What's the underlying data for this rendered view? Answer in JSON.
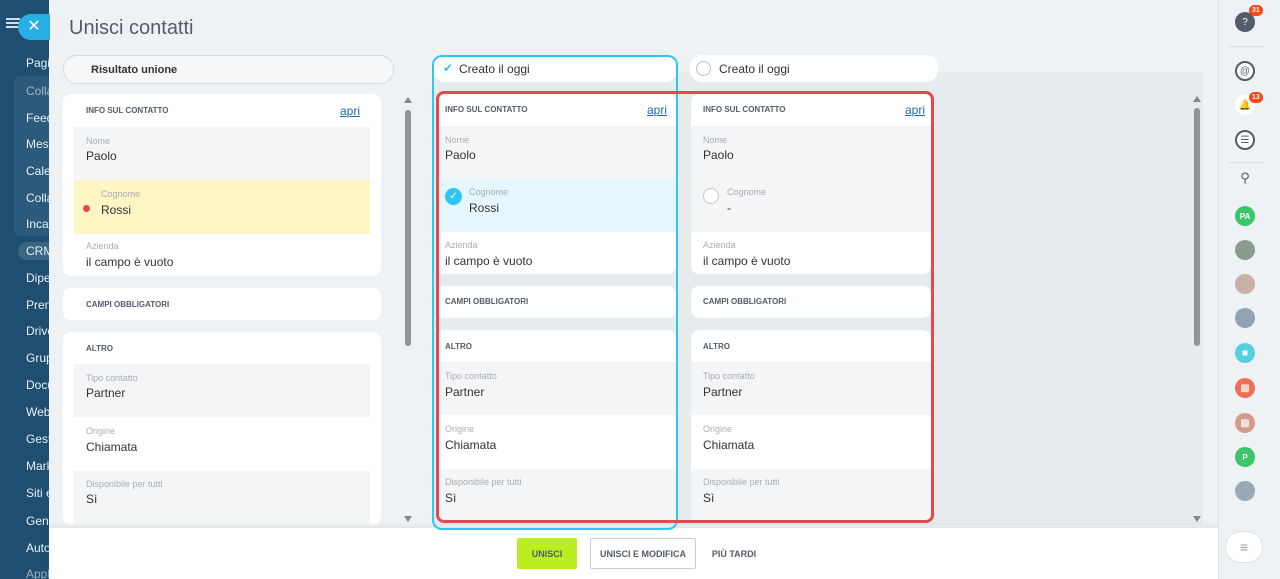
{
  "app_sidebar": {
    "items": [
      "Pagin",
      "Colla",
      "Feed",
      "Mess",
      "Cale",
      "Colla",
      "Incar",
      "CRM",
      "Dipe",
      "Pren",
      "Drive",
      "Grup",
      "Docu",
      "Web",
      "Gest",
      "Mark",
      "Siti e",
      "Gene",
      "Auto",
      "Appl"
    ]
  },
  "slider": {
    "title": "Unisci contatti",
    "result_header": "Risultato unione",
    "column_a": {
      "label": "Creato il oggi"
    },
    "column_b": {
      "label": "Creato il oggi"
    }
  },
  "result": {
    "info_title": "INFO SUL CONTATTO",
    "open_link": "apri",
    "fields": [
      {
        "label": "Nome",
        "value": "Paolo"
      },
      {
        "label": "Cognome",
        "value": "Rossi"
      },
      {
        "label": "Azienda",
        "value": "il campo è vuoto"
      }
    ],
    "required_title": "CAMPI OBBLIGATORI",
    "other_title": "ALTRO",
    "other_fields": [
      {
        "label": "Tipo contatto",
        "value": "Partner"
      },
      {
        "label": "Origine",
        "value": "Chiamata"
      },
      {
        "label": "Disponibile per tutti",
        "value": "Sì"
      }
    ]
  },
  "contact_a": {
    "info_title": "INFO SUL CONTATTO",
    "open_link": "apri",
    "fields": [
      {
        "label": "Nome",
        "value": "Paolo"
      },
      {
        "label": "Cognome",
        "value": "Rossi"
      },
      {
        "label": "Azienda",
        "value": "il campo è vuoto"
      }
    ],
    "required_title": "CAMPI OBBLIGATORI",
    "other_title": "ALTRO",
    "other_fields": [
      {
        "label": "Tipo contatto",
        "value": "Partner"
      },
      {
        "label": "Origine",
        "value": "Chiamata"
      },
      {
        "label": "Disponibile per tutti",
        "value": "Sì"
      }
    ]
  },
  "contact_b": {
    "info_title": "INFO SUL CONTATTO",
    "open_link": "apri",
    "fields": [
      {
        "label": "Nome",
        "value": "Paolo"
      },
      {
        "label": "Cognome",
        "value": "-"
      },
      {
        "label": "Azienda",
        "value": "il campo è vuoto"
      }
    ],
    "required_title": "CAMPI OBBLIGATORI",
    "other_title": "ALTRO",
    "other_fields": [
      {
        "label": "Tipo contatto",
        "value": "Partner"
      },
      {
        "label": "Origine",
        "value": "Chiamata"
      },
      {
        "label": "Disponibile per tutti",
        "value": "Sì"
      }
    ]
  },
  "footer": {
    "merge": "UNISCI",
    "merge_edit": "UNISCI E MODIFICA",
    "later": "PIÙ TARDI"
  },
  "right_panel": {
    "help_badge": "31",
    "notifications_badge": "13",
    "avatar_pa": "PA",
    "avatar_p": "P"
  },
  "colors": {
    "accent": "#2fc6f6",
    "merge_button": "#bbed21",
    "highlight_frame": "#e5484d",
    "changed_field": "#fdf5c3"
  }
}
